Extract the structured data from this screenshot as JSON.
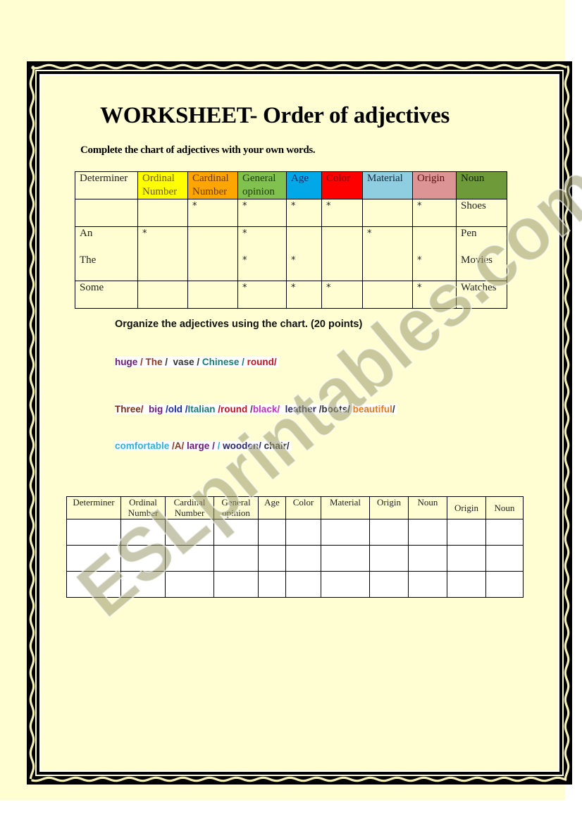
{
  "worksheet": {
    "title": "WORKSHEET- Order of adjectives",
    "subtitle": "Complete the chart of adjectives with your own words.",
    "chart1": {
      "headers": [
        {
          "label": "Determiner",
          "bg": "#fefed2",
          "color": "#222222"
        },
        {
          "label": "Ordinal Number",
          "bg": "#ffff00",
          "color": "#6b5a00"
        },
        {
          "label": "Cardinal Number",
          "bg": "#ffa500",
          "color": "#6b3a00"
        },
        {
          "label": "General opinion",
          "bg": "#80c150",
          "color": "#1f3b10"
        },
        {
          "label": "Age",
          "bg": "#00a8e8",
          "color": "#0a2a6a"
        },
        {
          "label": "Color",
          "bg": "#ff0000",
          "color": "#8a0000"
        },
        {
          "label": "Material",
          "bg": "#8fcde0",
          "color": "#1a2a40"
        },
        {
          "label": "Origin",
          "bg": "#dc9494",
          "color": "#5a1010"
        },
        {
          "label": "Noun",
          "bg": "#6e9a3a",
          "color": "#102008"
        }
      ],
      "rows": [
        {
          "cells": [
            [
              ""
            ],
            [
              ""
            ],
            [
              "*"
            ],
            [
              "*"
            ],
            [
              "*"
            ],
            [
              "*"
            ],
            [
              ""
            ],
            [
              "*"
            ],
            [
              "Shoes"
            ]
          ]
        },
        {
          "cells": [
            [
              "An",
              "The"
            ],
            [
              "*",
              ""
            ],
            [
              "",
              ""
            ],
            [
              "*",
              "*"
            ],
            [
              "",
              "*"
            ],
            [
              "",
              ""
            ],
            [
              "*",
              ""
            ],
            [
              "",
              "*"
            ],
            [
              "Pen",
              "Movies"
            ]
          ]
        },
        {
          "cells": [
            [
              "Some"
            ],
            [
              ""
            ],
            [
              ""
            ],
            [
              "*"
            ],
            [
              "*"
            ],
            [
              "*"
            ],
            [
              ""
            ],
            [
              "*"
            ],
            [
              "Watches"
            ]
          ]
        }
      ]
    },
    "instruction": "Organize the adjectives using the chart. (20 points)",
    "word_lines": [
      [
        {
          "text": "huge",
          "color": "#6a1a7a"
        },
        {
          "text": " / ",
          "color": "#8a3a1a"
        },
        {
          "text": "The",
          "color": "#8a3a1a"
        },
        {
          "text": " /  ",
          "color": "#333333"
        },
        {
          "text": "vase",
          "color": "#333333"
        },
        {
          "text": " / ",
          "color": "#333333"
        },
        {
          "text": "Chinese",
          "color": "#1a7a7a"
        },
        {
          "text": " / ",
          "color": "#1a7a7a"
        },
        {
          "text": "round/",
          "color": "#c0141e"
        }
      ],
      [
        {
          "text": "Three/",
          "color": "#7a3010"
        },
        {
          "text": "  big",
          "color": "#6a1a7a"
        },
        {
          "text": " /old",
          "color": "#1a2aa0"
        },
        {
          "text": " /",
          "color": "#1a2aa0"
        },
        {
          "text": "Italian",
          "color": "#1a7a7a"
        },
        {
          "text": " /round",
          "color": "#c0141e"
        },
        {
          "text": " /",
          "color": "#444444"
        },
        {
          "text": "black/",
          "color": "#c030c0"
        },
        {
          "text": "  leather",
          "color": "#2a2a60"
        },
        {
          "text": " /boots/",
          "color": "#333333"
        },
        {
          "text": " beautiful",
          "color": "#e07a20"
        },
        {
          "text": "/",
          "color": "#333333"
        }
      ],
      [
        {
          "text": "comfortable",
          "color": "#30b0d8"
        },
        {
          "text": " /A/",
          "color": "#8a3a1a"
        },
        {
          "text": " large",
          "color": "#6a1a7a"
        },
        {
          "text": " / ",
          "color": "#6a1a7a"
        },
        {
          "text": "/ ",
          "color": "#30b0d8"
        },
        {
          "text": "wooden/",
          "color": "#2a2a60"
        },
        {
          "text": " chair/",
          "color": "#333333"
        }
      ]
    ],
    "chart2": {
      "headers": [
        "Determiner",
        "Ordinal Number",
        "Cardinal Number",
        "General opinion",
        "Age",
        "Color",
        "Material",
        "Origin",
        "Noun",
        "Origin",
        "Noun"
      ],
      "empty_rows": 3
    },
    "watermark": "ESLprintables.com"
  }
}
